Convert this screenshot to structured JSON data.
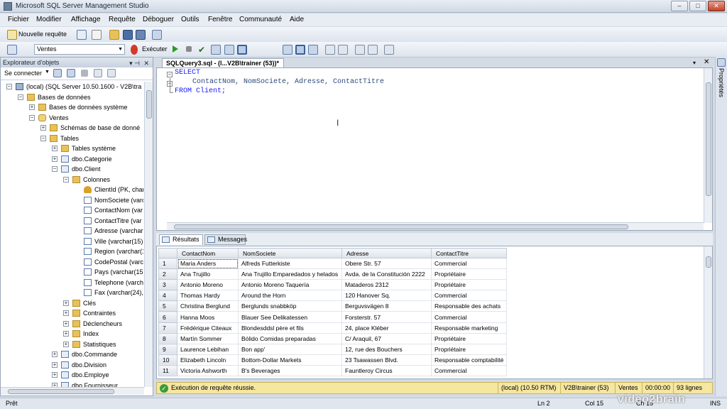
{
  "window": {
    "title": "Microsoft SQL Server Management Studio"
  },
  "menu": [
    "Fichier",
    "Modifier",
    "Affichage",
    "Requête",
    "Déboguer",
    "Outils",
    "Fenêtre",
    "Communauté",
    "Aide"
  ],
  "toolbar1": {
    "new_query": "Nouvelle requête"
  },
  "toolbar2": {
    "database": "Ventes",
    "execute": "Exécuter"
  },
  "explorer": {
    "title": "Explorateur d'objets",
    "connect": "Se connecter",
    "nodes": [
      {
        "label": "(local) (SQL Server 10.50.1600 - V2B\\tra",
        "exp": "−",
        "icon": "server"
      },
      {
        "label": "Bases de données",
        "exp": "−",
        "icon": "folder"
      },
      {
        "label": "Bases de données système",
        "exp": "+",
        "icon": "folder"
      },
      {
        "label": "Ventes",
        "exp": "−",
        "icon": "db"
      },
      {
        "label": "Schémas de base de donné",
        "exp": "+",
        "icon": "folder"
      },
      {
        "label": "Tables",
        "exp": "−",
        "icon": "folder"
      },
      {
        "label": "Tables système",
        "exp": "+",
        "icon": "folder"
      },
      {
        "label": "dbo.Categorie",
        "exp": "+",
        "icon": "table"
      },
      {
        "label": "dbo.Client",
        "exp": "−",
        "icon": "table"
      },
      {
        "label": "Colonnes",
        "exp": "−",
        "icon": "folder"
      },
      {
        "label": "ClientId (PK, char",
        "exp": "",
        "icon": "key"
      },
      {
        "label": "NomSociete (varc",
        "exp": "",
        "icon": "col"
      },
      {
        "label": "ContactNom (var",
        "exp": "",
        "icon": "col"
      },
      {
        "label": "ContactTitre (var",
        "exp": "",
        "icon": "col"
      },
      {
        "label": "Adresse (varchar(",
        "exp": "",
        "icon": "col"
      },
      {
        "label": "Ville (varchar(15),",
        "exp": "",
        "icon": "col"
      },
      {
        "label": "Region (varchar(1",
        "exp": "",
        "icon": "col"
      },
      {
        "label": "CodePostal (varc",
        "exp": "",
        "icon": "col"
      },
      {
        "label": "Pays (varchar(15)",
        "exp": "",
        "icon": "col"
      },
      {
        "label": "Telephone (varch",
        "exp": "",
        "icon": "col"
      },
      {
        "label": "Fax (varchar(24),",
        "exp": "",
        "icon": "col"
      },
      {
        "label": "Clés",
        "exp": "+",
        "icon": "folder"
      },
      {
        "label": "Contraintes",
        "exp": "+",
        "icon": "folder"
      },
      {
        "label": "Déclencheurs",
        "exp": "+",
        "icon": "folder"
      },
      {
        "label": "Index",
        "exp": "+",
        "icon": "folder"
      },
      {
        "label": "Statistiques",
        "exp": "+",
        "icon": "folder"
      },
      {
        "label": "dbo.Commande",
        "exp": "+",
        "icon": "table"
      },
      {
        "label": "dbo.Division",
        "exp": "+",
        "icon": "table"
      },
      {
        "label": "dbo.Employe",
        "exp": "+",
        "icon": "table"
      },
      {
        "label": "dbo.Fournisseur",
        "exp": "+",
        "icon": "table"
      }
    ]
  },
  "document": {
    "tab": "SQLQuery3.sql - (l...V2B\\trainer (53))*"
  },
  "sql": {
    "line1": "SELECT",
    "line2_a": "ContactNom",
    "line2_b": ", NomSociete, Adresse, ContactTitre",
    "line3": "FROM Client;"
  },
  "results": {
    "tab_results": "Résultats",
    "tab_messages": "Messages",
    "columns": [
      "ContactNom",
      "NomSociete",
      "Adresse",
      "ContactTitre"
    ],
    "rows": [
      [
        "1",
        "Maria Anders",
        "Alfreds Futterkiste",
        "Obere Str. 57",
        "Commercial"
      ],
      [
        "2",
        "Ana Trujillo",
        "Ana Trujillo Emparedados y helados",
        "Avda. de la Constitución 2222",
        "Propriétaire"
      ],
      [
        "3",
        "Antonio Moreno",
        "Antonio Moreno Taquería",
        "Mataderos  2312",
        "Propriétaire"
      ],
      [
        "4",
        "Thomas Hardy",
        "Around the Horn",
        "120 Hanover Sq.",
        "Commercial"
      ],
      [
        "5",
        "Christina Berglund",
        "Berglunds snabbköp",
        "Berguvsvägen  8",
        "Responsable des achats"
      ],
      [
        "6",
        "Hanna Moos",
        "Blauer See Delikatessen",
        "Forsterstr. 57",
        "Commercial"
      ],
      [
        "7",
        "Frédérique Citeaux",
        "Blondesddsl père et fils",
        "24, place Kléber",
        "Responsable marketing"
      ],
      [
        "8",
        "Martín Sommer",
        "Bólido Comidas preparadas",
        "C/ Araquil, 67",
        "Propriétaire"
      ],
      [
        "9",
        "Laurence Lebihan",
        "Bon app'",
        "12, rue des Bouchers",
        "Propriétaire"
      ],
      [
        "10",
        "Elizabeth Lincoln",
        "Bottom-Dollar Markets",
        "23 Tsawassen Blvd.",
        "Responsable comptabilité"
      ],
      [
        "11",
        "Victoria Ashworth",
        "B's Beverages",
        "Fauntleroy Circus",
        "Commercial"
      ]
    ]
  },
  "status": {
    "message": "Exécution de requête réussie.",
    "server": "(local) (10.50 RTM)",
    "user": "V2B\\trainer (53)",
    "db": "Ventes",
    "time": "00:00:00",
    "rows": "93 lignes"
  },
  "bottom": {
    "ready": "Prêt",
    "ln": "Ln 2",
    "col": "Col 15",
    "ch": "Ch 15",
    "ins": "INS"
  },
  "properties_strip": "Propriétés",
  "watermark": "video2brain"
}
